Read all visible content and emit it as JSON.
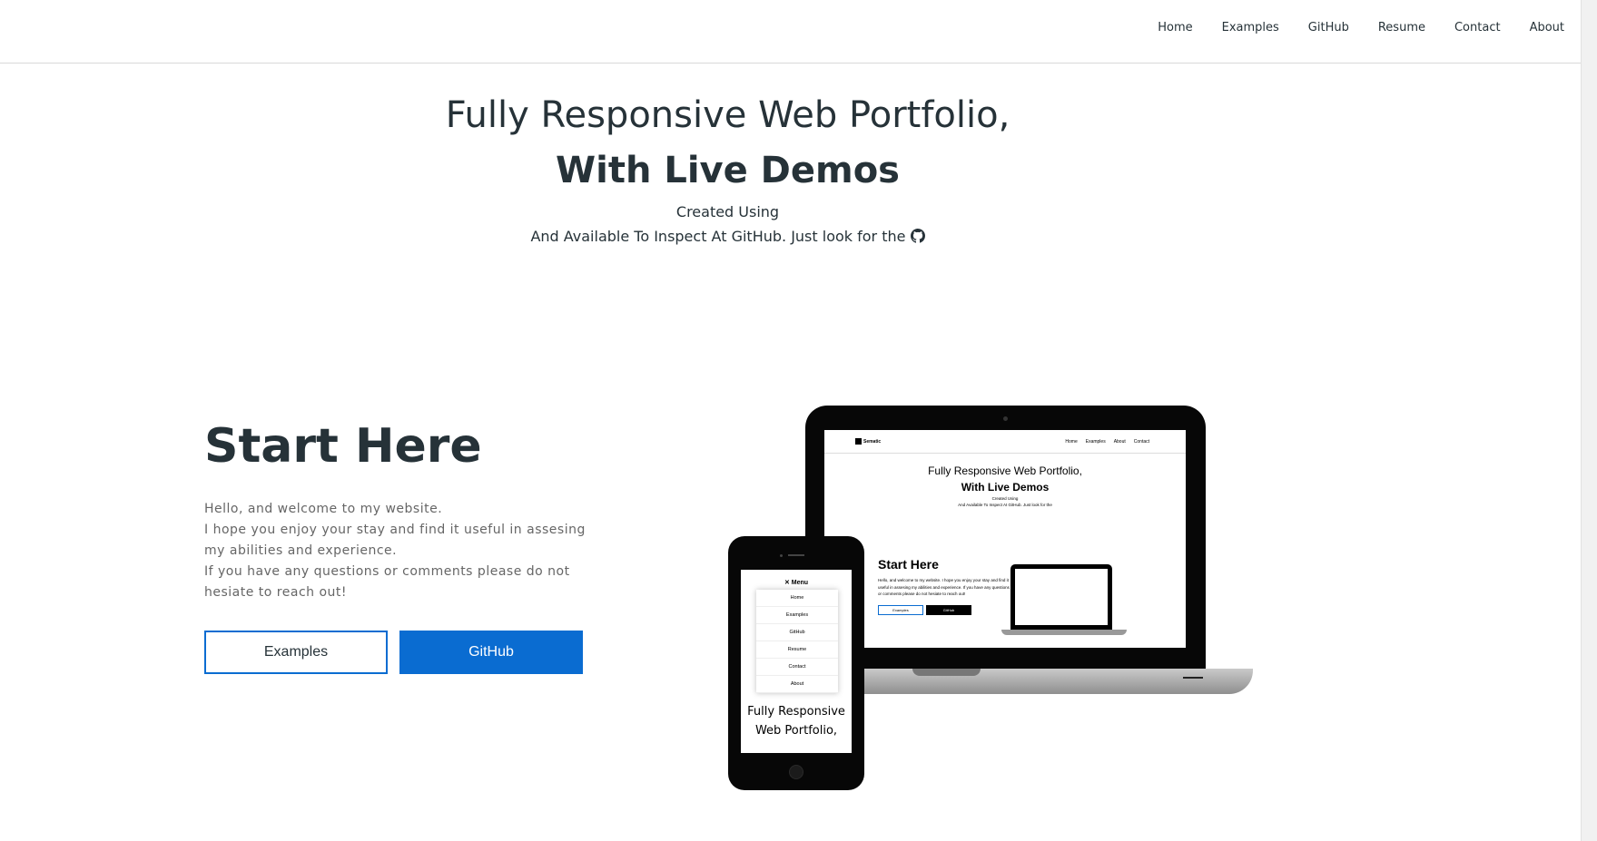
{
  "nav": {
    "items": [
      "Home",
      "Examples",
      "GitHub",
      "Resume",
      "Contact",
      "About"
    ]
  },
  "hero": {
    "title": "Fully Responsive Web Portfolio,",
    "subtitle": "With Live Demos",
    "line1": "Created Using",
    "line2": "And Available To Inspect At GitHub. Just look for the",
    "line2_icon": "github-icon"
  },
  "start": {
    "title": "Start Here",
    "paragraphs": [
      "Hello, and welcome to my website.",
      "I hope you enjoy your stay and find it useful in assesing my abilities and experience.",
      "If you have any questions or comments please do not hesiate to reach out!"
    ],
    "buttons": {
      "examples": "Examples",
      "github": "GitHub"
    }
  },
  "mockup": {
    "logo": "Sematic",
    "links": [
      "Home",
      "Examples",
      "About",
      "Contact"
    ],
    "title": "Fully Responsive Web Portfolio,",
    "subtitle": "With Live Demos",
    "line1": "Created Using",
    "line2": "And Available To Inspect At GitHub. Just look for the",
    "start_title": "Start Here",
    "start_text": "Hello, and welcome to my website. I hope you enjoy your stay and find it useful in assesing my abilities and experience. If you have any questions or comments please do not hesiate to reach out!",
    "btn_examples": "Examples",
    "btn_github": "GitHub"
  },
  "phone": {
    "menu_label": "Menu",
    "menu_items": [
      "Home",
      "Examples",
      "GitHub",
      "Resume",
      "Contact",
      "About"
    ],
    "title": "Fully Responsive Web Portfolio,"
  },
  "colors": {
    "accent": "#0a6cd1",
    "text": "#263238",
    "muted": "#666666"
  }
}
